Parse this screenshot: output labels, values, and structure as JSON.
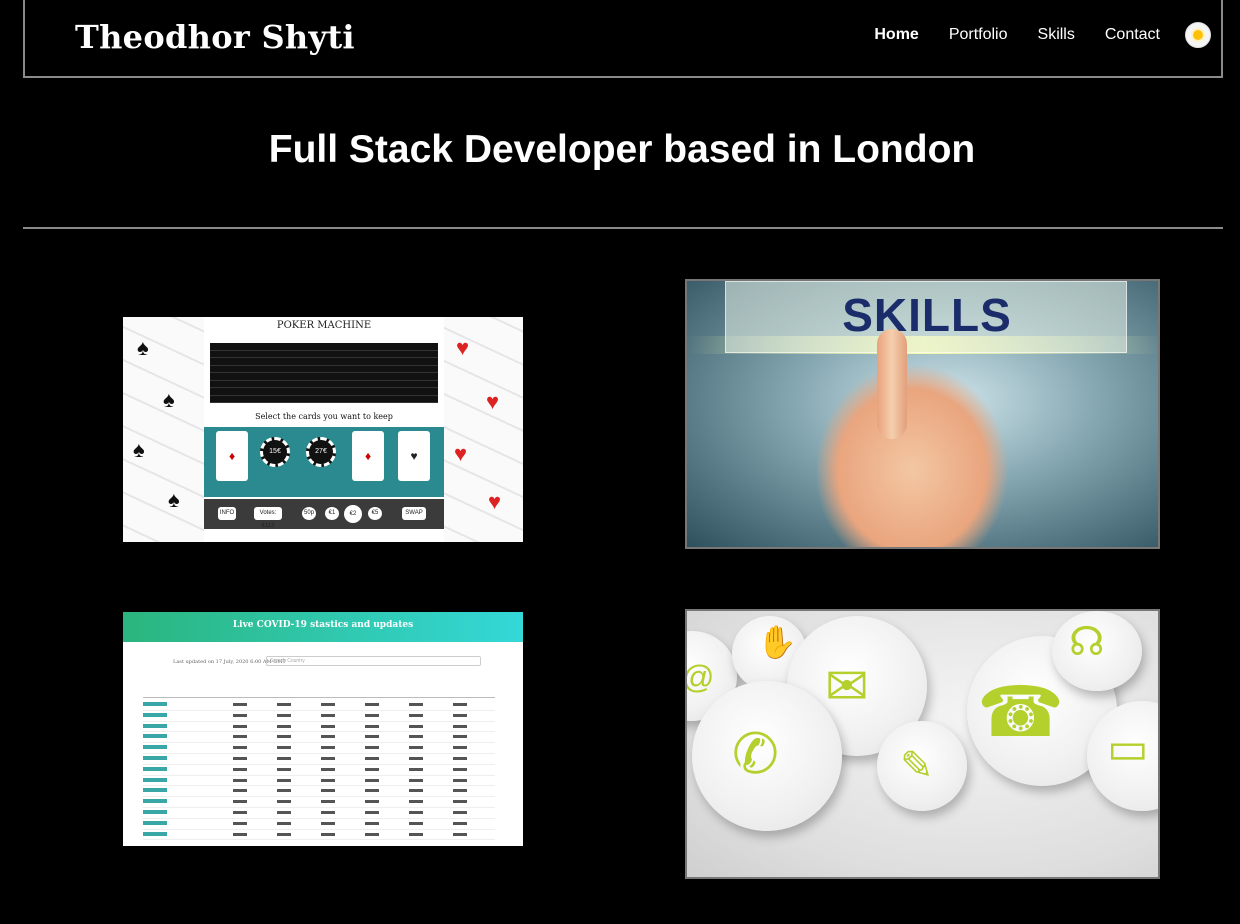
{
  "header": {
    "brand": "Theodhor Shyti",
    "nav": [
      {
        "label": "Home",
        "active": true
      },
      {
        "label": "Portfolio",
        "active": false
      },
      {
        "label": "Skills",
        "active": false
      },
      {
        "label": "Contact",
        "active": false
      }
    ],
    "theme_toggle_icon": "sun-icon"
  },
  "hero": {
    "title": "Full Stack Developer based in London"
  },
  "cards": {
    "poker": {
      "title": "POKER MACHINE",
      "prompt": "Select the cards you want to keep",
      "chips": [
        "15€",
        "27€"
      ],
      "buttons": [
        "INFO",
        "Votes: €113",
        "50p",
        "€1",
        "€2",
        "€5",
        "SWAP"
      ]
    },
    "skills": {
      "banner": "SKILLS"
    },
    "covid": {
      "title": "Live COVID-19 stastics and updates",
      "updated": "Last updated on 17 July, 2020 6:00 AM GMT",
      "search_placeholder": "Search Country"
    },
    "contact": {
      "icons": [
        "email-icon",
        "phone-icon",
        "telephone-icon",
        "headset-icon",
        "handshake-icon",
        "pencil-icon",
        "laptop-icon"
      ]
    }
  },
  "colors": {
    "background": "#000000",
    "accent_green": "#b4d02d",
    "skills_text": "#1b2c6b",
    "covid_teal": "#2bb57e"
  }
}
